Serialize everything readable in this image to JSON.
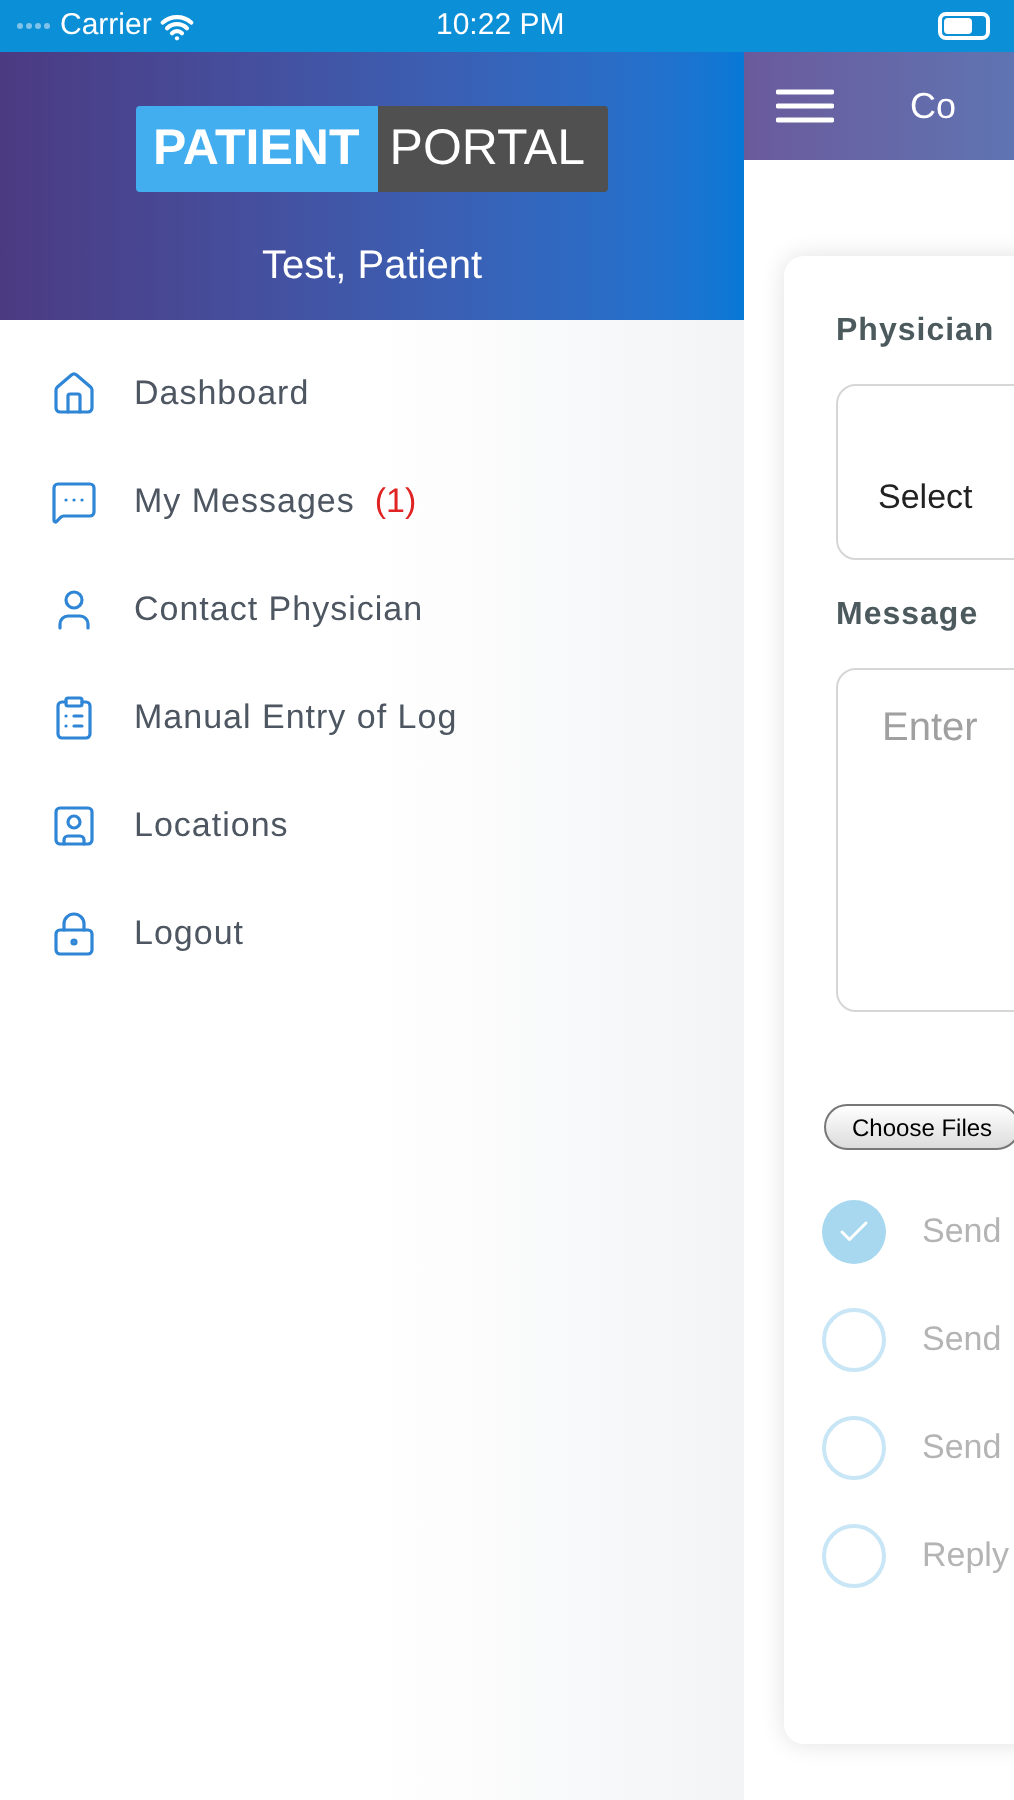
{
  "status_bar": {
    "carrier": "Carrier",
    "time": "10:22 PM"
  },
  "drawer": {
    "logo": {
      "part_1": "PATIENT",
      "part_2": "PORTAL"
    },
    "user_name": "Test, Patient",
    "items": [
      {
        "kind": "home",
        "label": "Dashboard"
      },
      {
        "kind": "messages",
        "label": "My Messages",
        "badge": "(1)"
      },
      {
        "kind": "person",
        "label": "Contact Physician"
      },
      {
        "kind": "clipboard",
        "label": "Manual Entry of Log"
      },
      {
        "kind": "contact-card",
        "label": "Locations"
      },
      {
        "kind": "lock",
        "label": "Logout"
      }
    ]
  },
  "page": {
    "title": "Co",
    "form": {
      "physician_label": "Physician",
      "physician_value": "Select",
      "message_label": "Message",
      "message_placeholder": "Enter",
      "file_button": "Choose Files",
      "options": [
        {
          "label": "Send",
          "selected": true
        },
        {
          "label": "Send",
          "selected": false
        },
        {
          "label": "Send",
          "selected": false
        },
        {
          "label": "Reply",
          "selected": false
        }
      ]
    }
  }
}
